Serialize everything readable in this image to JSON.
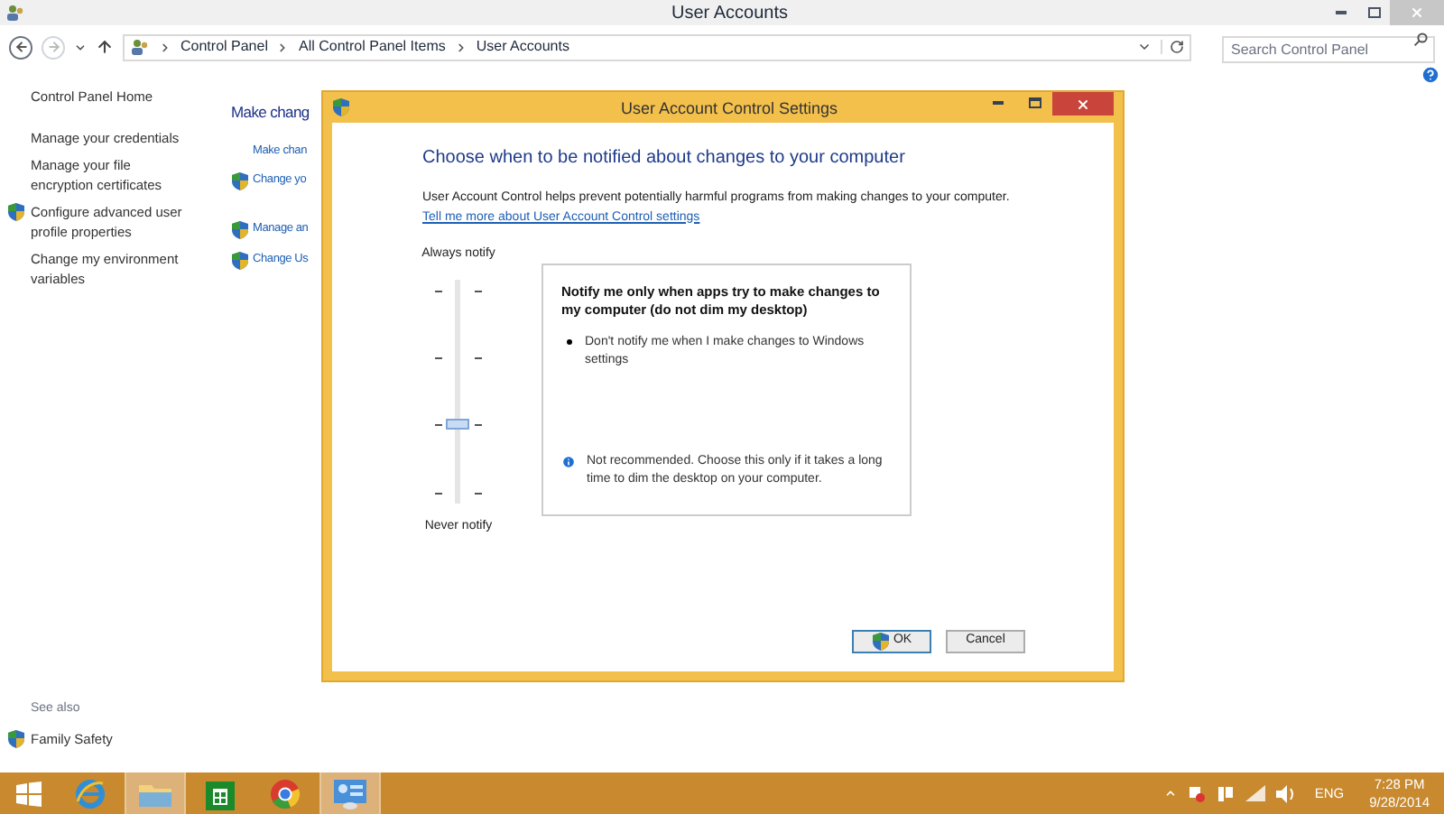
{
  "window": {
    "title": "User Accounts"
  },
  "address": {
    "crumbs": [
      "Control Panel",
      "All Control Panel Items",
      "User Accounts"
    ]
  },
  "search": {
    "placeholder": "Search Control Panel"
  },
  "sidebar": {
    "items": [
      {
        "label": "Control Panel Home",
        "shield": false
      },
      {
        "label": "Manage your credentials",
        "shield": false
      },
      {
        "label": "Manage your file encryption certificates",
        "shield": false
      },
      {
        "label": "Configure advanced user profile properties",
        "shield": true
      },
      {
        "label": "Change my environment variables",
        "shield": false
      }
    ],
    "see_also": {
      "heading": "See also",
      "items": [
        {
          "label": "Family Safety",
          "shield": true
        }
      ]
    }
  },
  "main": {
    "heading": "Make chang",
    "links": [
      {
        "label": "Make chan",
        "shield": false,
        "gap": false
      },
      {
        "label": "Change yo",
        "shield": true,
        "gap": false
      },
      {
        "label": "Manage an",
        "shield": true,
        "gap": true
      },
      {
        "label": "Change Us",
        "shield": true,
        "gap": false
      }
    ]
  },
  "dialog": {
    "title": "User Account Control Settings",
    "heading": "Choose when to be notified about changes to your computer",
    "description": "User Account Control helps prevent potentially harmful programs from making changes to your computer.",
    "link": "Tell me more about User Account Control settings",
    "slider": {
      "top_label": "Always notify",
      "bottom_label": "Never notify",
      "level": 0.3333
    },
    "info": {
      "title": "Notify me only when apps try to make changes to my computer (do not dim my desktop)",
      "bullet": "Don't notify me when I make changes to Windows settings",
      "note": "Not recommended. Choose this only if it takes a long time to dim the desktop on your computer."
    },
    "buttons": [
      {
        "label": "OK",
        "shield": true,
        "default": true
      },
      {
        "label": "Cancel",
        "shield": false,
        "default": false
      }
    ]
  },
  "taskbar": {
    "apps": [
      {
        "kind": "ie",
        "active": false
      },
      {
        "kind": "explorer",
        "active": true
      },
      {
        "kind": "store",
        "active": false
      },
      {
        "kind": "chrome",
        "active": false
      },
      {
        "kind": "control",
        "active": true
      }
    ],
    "language": "ENG",
    "time": "7:28 PM",
    "date": "9/28/2014"
  }
}
